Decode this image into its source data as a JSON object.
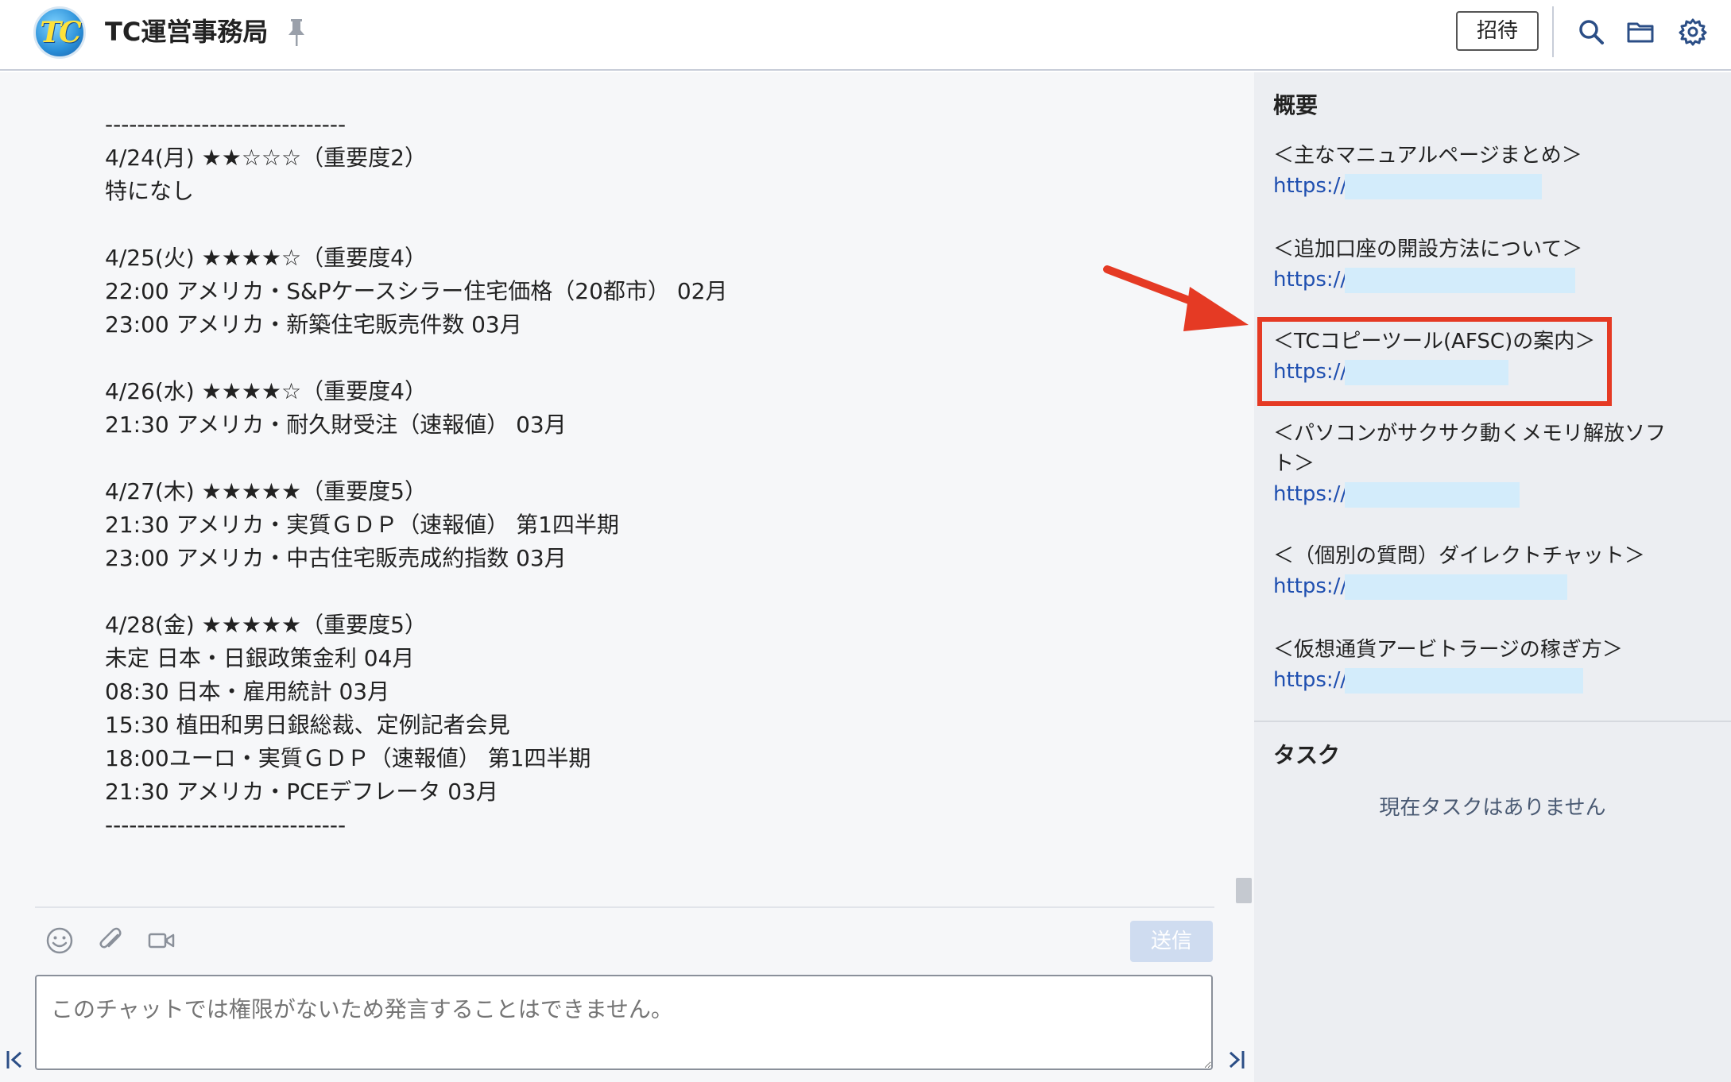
{
  "header": {
    "logo_text": "TC",
    "room_title": "TC運営事務局",
    "invite_label": "招待"
  },
  "messages": {
    "lines": [
      "------------------------------",
      "4/24(月) ★★☆☆☆（重要度2）",
      "特になし",
      "",
      "4/25(火) ★★★★☆（重要度4）",
      "22:00 アメリカ・S&Pケースシラー住宅価格（20都市） 02月",
      "23:00 アメリカ・新築住宅販売件数 03月",
      "",
      "4/26(水) ★★★★☆（重要度4）",
      "21:30 アメリカ・耐久財受注（速報値） 03月",
      "",
      "4/27(木) ★★★★★（重要度5）",
      "21:30 アメリカ・実質ＧＤＰ（速報値） 第1四半期",
      "23:00 アメリカ・中古住宅販売成約指数 03月",
      "",
      "4/28(金) ★★★★★（重要度5）",
      "未定 日本・日銀政策金利 04月",
      "08:30 日本・雇用統計 03月",
      "15:30 植田和男日銀総裁、定例記者会見",
      "18:00ユーロ・実質ＧＤＰ（速報値） 第1四半期",
      "21:30 アメリカ・PCEデフレータ 03月",
      "------------------------------"
    ]
  },
  "composer": {
    "send_label": "送信",
    "input_placeholder": "このチャットでは権限がないため発言することはできません。"
  },
  "side": {
    "overview_title": "概要",
    "entries": [
      {
        "label": "＜主なマニュアルページまとめ＞",
        "url": "https://"
      },
      {
        "label": "＜追加口座の開設方法について＞",
        "url": "https://"
      },
      {
        "label": "＜TCコピーツール(AFSC)の案内＞",
        "url": "https://"
      },
      {
        "label": "＜パソコンがサクサク動くメモリ解放ソフ",
        "label2": "ト＞",
        "url": "https://"
      },
      {
        "label": "＜（個別の質問）ダイレクトチャット＞",
        "url": "https://"
      },
      {
        "label": "＜仮想通貨アービトラージの稼ぎ方＞",
        "url": "https://"
      }
    ],
    "tasks_title": "タスク",
    "tasks_empty": "現在タスクはありません"
  },
  "colors": {
    "link": "#1f4fb0",
    "highlight": "#e53a24",
    "redaction": "#d3ecfb"
  }
}
